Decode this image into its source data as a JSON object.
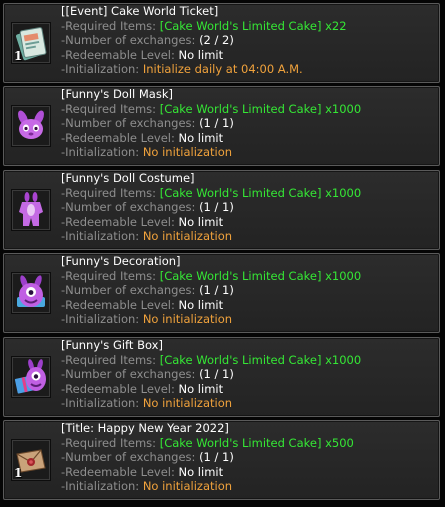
{
  "labels": {
    "required_items": "-Required Items: ",
    "number_of_exchanges": "-Number of exchanges: ",
    "redeemable_level": "-Redeemable Level: ",
    "initialization": "-Initialization: "
  },
  "items": [
    {
      "title": "[[Event] Cake World Ticket]",
      "required": "[Cake World's Limited Cake] x22",
      "exchanges": "(2 / 2)",
      "level": "No limit",
      "initialization": "Initialize daily at 04:00 A.M.",
      "qty": "1",
      "icon": "ticket-icon"
    },
    {
      "title": "[Funny's Doll Mask]",
      "required": "[Cake World's Limited Cake] x1000",
      "exchanges": "(1 / 1)",
      "level": "No limit",
      "initialization": "No initialization",
      "icon": "doll-mask-icon"
    },
    {
      "title": "[Funny's Doll Costume]",
      "required": "[Cake World's Limited Cake] x1000",
      "exchanges": "(1 / 1)",
      "level": "No limit",
      "initialization": "No initialization",
      "icon": "doll-costume-icon"
    },
    {
      "title": "[Funny's Decoration]",
      "required": "[Cake World's Limited Cake] x1000",
      "exchanges": "(1 / 1)",
      "level": "No limit",
      "initialization": "No initialization",
      "icon": "decoration-icon"
    },
    {
      "title": "[Funny's Gift Box]",
      "required": "[Cake World's Limited Cake] x1000",
      "exchanges": "(1 / 1)",
      "level": "No limit",
      "initialization": "No initialization",
      "icon": "gift-box-icon"
    },
    {
      "title": "[Title: Happy New Year 2022]",
      "required": "[Cake World's Limited Cake] x500",
      "exchanges": "(1 / 1)",
      "level": "No limit",
      "initialization": "No initialization",
      "qty": "1",
      "icon": "title-scroll-icon"
    }
  ],
  "colors": {
    "label_gray": "#8e8e8e",
    "required_green": "#35e735",
    "initialization_orange": "#f0a23c",
    "title_white": "#ffffff",
    "panel_border": "#5a5a5a"
  }
}
